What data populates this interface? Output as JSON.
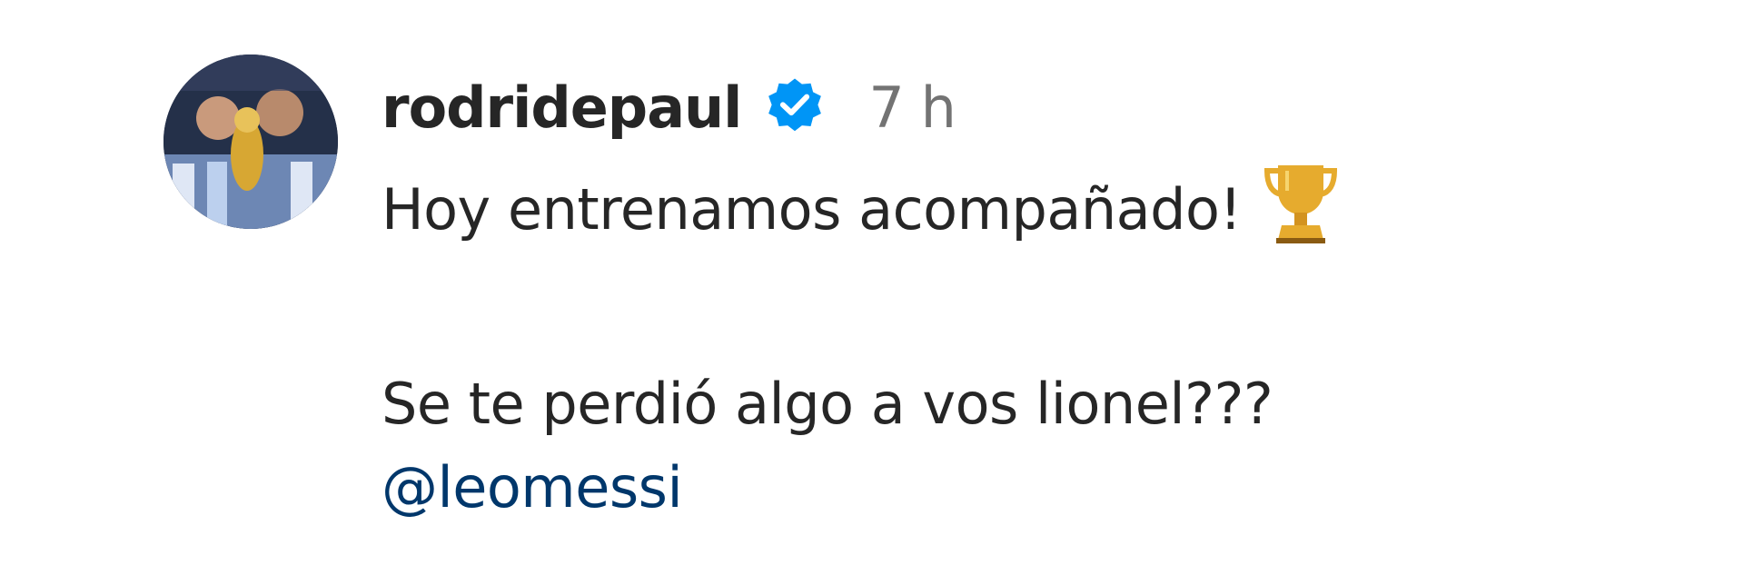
{
  "post": {
    "username": "rodridepaul",
    "verified_icon": "verified-badge-icon",
    "timestamp": "7 h",
    "caption": {
      "line1": "Hoy entrenamos acompañado!",
      "line1_emoji": "trophy-icon",
      "line2": "Se te perdió algo a vos lionel???",
      "mention": "@leomessi"
    }
  },
  "colors": {
    "text": "#262626",
    "muted": "#737373",
    "verified": "#0095f6",
    "mention": "#00376b",
    "trophy": "#e2a72d"
  }
}
